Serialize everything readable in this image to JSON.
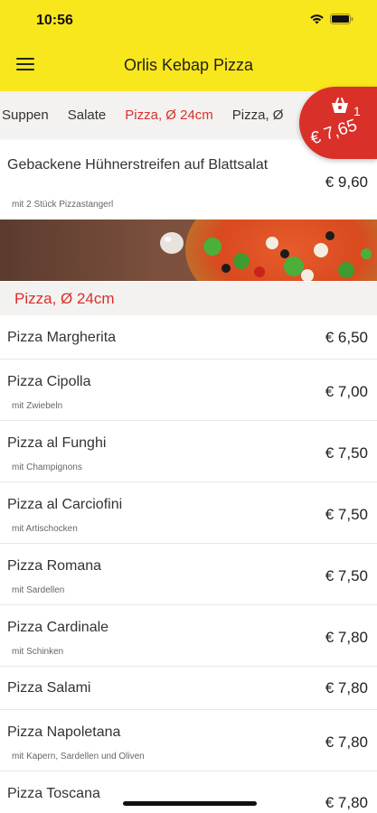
{
  "status_bar": {
    "time": "10:56"
  },
  "header": {
    "title": "Orlis Kebap Pizza",
    "menu_icon": "hamburger-menu-icon"
  },
  "tabs": [
    {
      "label": "Suppen",
      "active": false
    },
    {
      "label": "Salate",
      "active": false
    },
    {
      "label": "Pizza, Ø 24cm",
      "active": true
    },
    {
      "label": "Pizza, Ø",
      "active": false
    }
  ],
  "cart": {
    "count": "1",
    "total": "€ 7,65",
    "icon": "shopping-bag-icon"
  },
  "featured_item": {
    "name": "Gebackene Hühnerstreifen auf Blattsalat",
    "desc": "mit 2 Stück Pizzastangerl",
    "price": "€ 9,60"
  },
  "section": {
    "title": "Pizza, Ø 24cm"
  },
  "items": [
    {
      "name": "Pizza Margherita",
      "desc": "",
      "price": "€ 6,50"
    },
    {
      "name": "Pizza Cipolla",
      "desc": "mit Zwiebeln",
      "price": "€ 7,00"
    },
    {
      "name": "Pizza al Funghi",
      "desc": "mit Champignons",
      "price": "€ 7,50"
    },
    {
      "name": "Pizza al Carciofini",
      "desc": "mit Artischocken",
      "price": "€ 7,50"
    },
    {
      "name": "Pizza Romana",
      "desc": "mit Sardellen",
      "price": "€ 7,50"
    },
    {
      "name": "Pizza Cardinale",
      "desc": "mit Schinken",
      "price": "€ 7,80"
    },
    {
      "name": "Pizza Salami",
      "desc": "",
      "price": "€ 7,80"
    },
    {
      "name": "Pizza Napoletana",
      "desc": "mit Kapern, Sardellen und Oliven",
      "price": "€ 7,80"
    },
    {
      "name": "Pizza Toscana",
      "desc": "",
      "price": "€ 7,80"
    }
  ],
  "colors": {
    "header_bg": "#f8e71c",
    "accent": "#d9302a",
    "tab_bar_bg": "#f3f2f1"
  }
}
